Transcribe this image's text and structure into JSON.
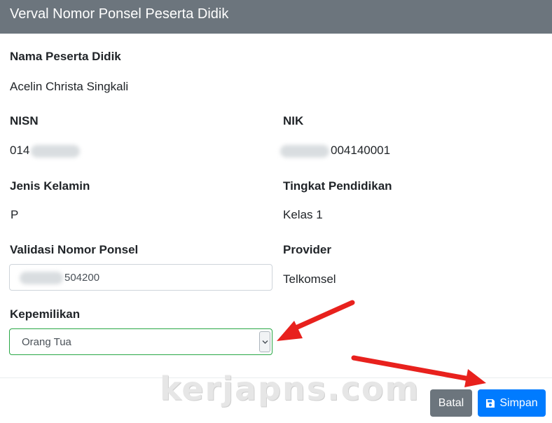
{
  "modal": {
    "title": "Verval Nomor Ponsel Peserta Didik"
  },
  "student": {
    "name_label": "Nama Peserta Didik",
    "name_value": "Acelin Christa Singkali",
    "nisn_label": "NISN",
    "nisn_value_visible": "014",
    "nik_label": "NIK",
    "nik_value_visible": "004140001",
    "gender_label": "Jenis Kelamin",
    "gender_value": "P",
    "level_label": "Tingkat Pendidikan",
    "level_value": "Kelas 1"
  },
  "phone": {
    "label": "Validasi Nomor Ponsel",
    "value_visible": "504200",
    "provider_label": "Provider",
    "provider_value": "Telkomsel"
  },
  "ownership": {
    "label": "Kepemilikan",
    "selected": "Orang Tua"
  },
  "footer": {
    "cancel_label": "Batal",
    "save_label": "Simpan",
    "watermark": "kerjapns.com"
  },
  "icons": {
    "save": "floppy-disk-icon",
    "select_arrow": "chevron-down-icon",
    "annotation": "red-arrow-icon"
  },
  "colors": {
    "header_bg": "#6c757d",
    "primary": "#007bff",
    "secondary": "#6c757d",
    "select_border": "#28a745",
    "annotation_arrow": "#e8211d"
  }
}
